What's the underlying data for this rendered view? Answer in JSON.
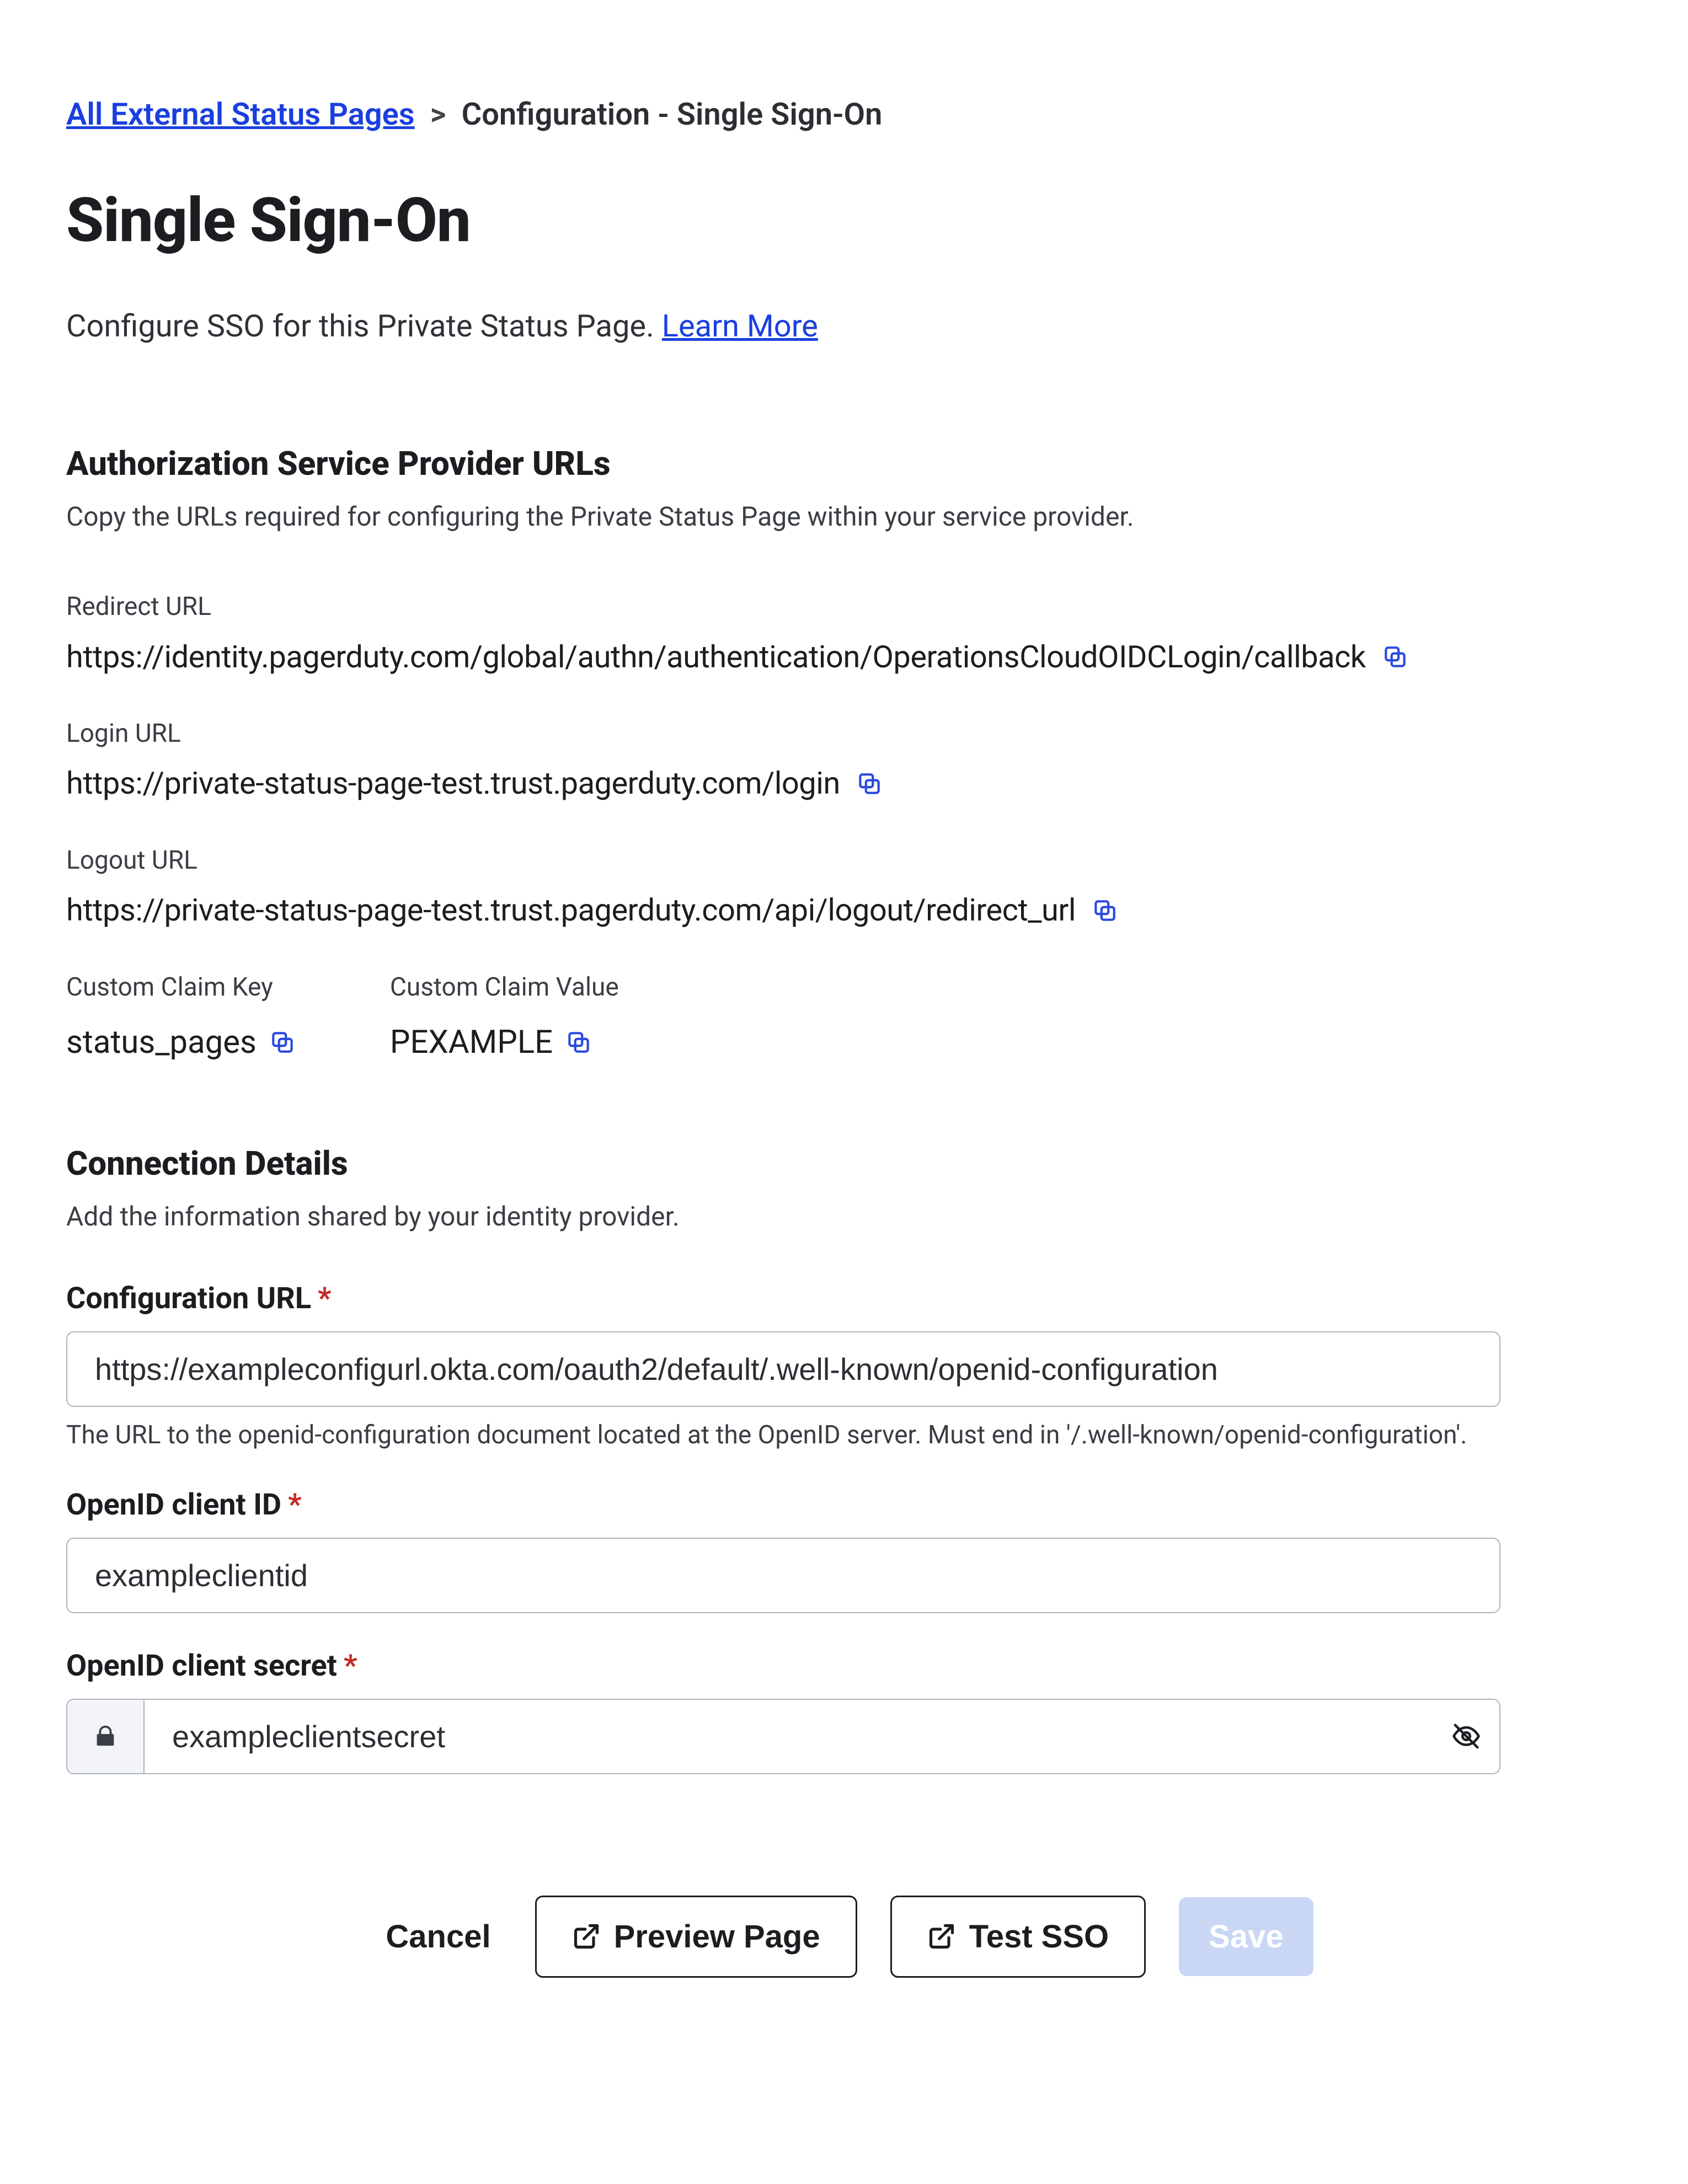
{
  "breadcrumb": {
    "back_label": "All External Status Pages",
    "separator": ">",
    "current": "Configuration - Single Sign-On"
  },
  "page": {
    "title": "Single Sign-On",
    "subtitle_text": "Configure SSO for this Private Status Page. ",
    "learn_more_label": "Learn More"
  },
  "auth_section": {
    "heading": "Authorization Service Provider URLs",
    "subtext": "Copy the URLs required for configuring the Private Status Page within your service provider.",
    "redirect": {
      "label": "Redirect URL",
      "value": "https://identity.pagerduty.com/global/authn/authentication/OperationsCloudOIDCLogin/callback"
    },
    "login": {
      "label": "Login URL",
      "value": "https://private-status-page-test.trust.pagerduty.com/login"
    },
    "logout": {
      "label": "Logout URL",
      "value": "https://private-status-page-test.trust.pagerduty.com/api/logout/redirect_url"
    },
    "claim_key": {
      "label": "Custom Claim Key",
      "value": "status_pages"
    },
    "claim_value": {
      "label": "Custom Claim Value",
      "value": "PEXAMPLE"
    }
  },
  "connection": {
    "heading": "Connection Details",
    "subtext": "Add the information shared by your identity provider.",
    "config_url": {
      "label": "Configuration URL",
      "value": "https://exampleconfigurl.okta.com/oauth2/default/.well-known/openid-configuration",
      "help": "The URL to the openid-configuration document located at the OpenID server. Must end in '/.well-known/openid-configuration'."
    },
    "client_id": {
      "label": "OpenID client ID",
      "value": "exampleclientid"
    },
    "client_secret": {
      "label": "OpenID client secret",
      "value": "exampleclientsecret"
    },
    "required_mark": "*"
  },
  "footer": {
    "cancel": "Cancel",
    "preview": "Preview Page",
    "test": "Test SSO",
    "save": "Save"
  }
}
